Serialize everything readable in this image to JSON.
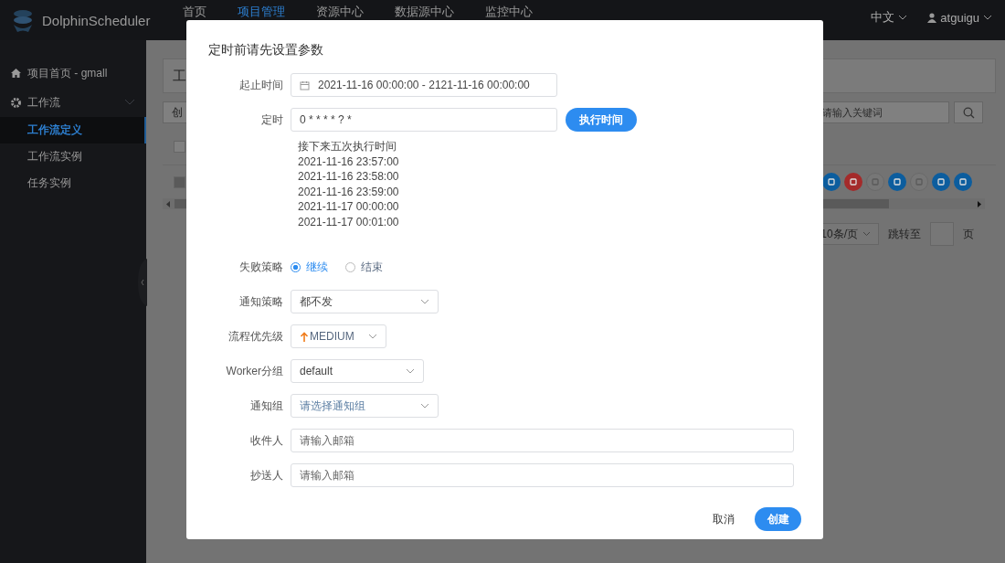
{
  "topbar": {
    "brand": "DolphinScheduler",
    "nav": [
      {
        "label": "首页",
        "selected": false
      },
      {
        "label": "项目管理",
        "selected": true
      },
      {
        "label": "资源中心",
        "selected": false
      },
      {
        "label": "数据源中心",
        "selected": false
      },
      {
        "label": "监控中心",
        "selected": false
      }
    ],
    "language": "中文",
    "user": "atguigu"
  },
  "sidebar": {
    "items": [
      {
        "label": "项目首页 - gmall",
        "selected": false
      },
      {
        "label": "工作流",
        "selected": false,
        "expanded": true,
        "children": [
          {
            "label": "工作流定义",
            "selected": true
          },
          {
            "label": "工作流实例",
            "selected": false
          },
          {
            "label": "任务实例",
            "selected": false
          }
        ]
      }
    ]
  },
  "background": {
    "title": "工",
    "create_button": "创",
    "search": {
      "placeholder": "请输入关键词"
    },
    "select_all": {
      "checked": false
    },
    "row": {
      "checked": false,
      "disabled": true
    },
    "actions": [
      {
        "color": "#0c5d9e",
        "disabled": false
      },
      {
        "color": "#a42a2a",
        "disabled": false
      },
      {
        "color": "#6a6a6a",
        "disabled": true
      },
      {
        "color": "#0c5d9e",
        "disabled": false
      },
      {
        "color": "#6a6a6a",
        "disabled": true
      },
      {
        "color": "#0c5d9e",
        "disabled": false
      },
      {
        "color": "#0c5d9e",
        "disabled": false
      }
    ],
    "pagination": {
      "page_size": "10条/页",
      "jump_label": "跳转至",
      "page_unit": "页"
    }
  },
  "modal": {
    "title": "定时前请先设置参数",
    "form": [
      {
        "kind": "daterange",
        "label": "起止时间",
        "value": "2021-11-16 00:00:00 - 2121-11-16 00:00:00"
      },
      {
        "kind": "cron",
        "label": "定时",
        "value": "0 * * * * ? *",
        "button": "执行时间",
        "next_title": "接下来五次执行时间",
        "next_times": [
          "2021-11-16 23:57:00",
          "2021-11-16 23:58:00",
          "2021-11-16 23:59:00",
          "2021-11-17 00:00:00",
          "2021-11-17 00:01:00"
        ]
      },
      {
        "kind": "radio",
        "label": "失败策略",
        "options": [
          {
            "label": "继续",
            "selected": true
          },
          {
            "label": "结束",
            "selected": false
          }
        ]
      },
      {
        "kind": "select",
        "label": "通知策略",
        "value": "都不发"
      },
      {
        "kind": "priority",
        "label": "流程优先级",
        "value": "MEDIUM"
      },
      {
        "kind": "select",
        "label": "Worker分组",
        "value": "default"
      },
      {
        "kind": "select",
        "label": "通知组",
        "placeholder": "请选择通知组"
      },
      {
        "kind": "input",
        "label": "收件人",
        "placeholder": "请输入邮箱"
      },
      {
        "kind": "input",
        "label": "抄送人",
        "placeholder": "请输入邮箱"
      }
    ],
    "buttons": [
      {
        "kind": "text",
        "label": "取消"
      },
      {
        "kind": "primary",
        "label": "创建"
      }
    ]
  }
}
